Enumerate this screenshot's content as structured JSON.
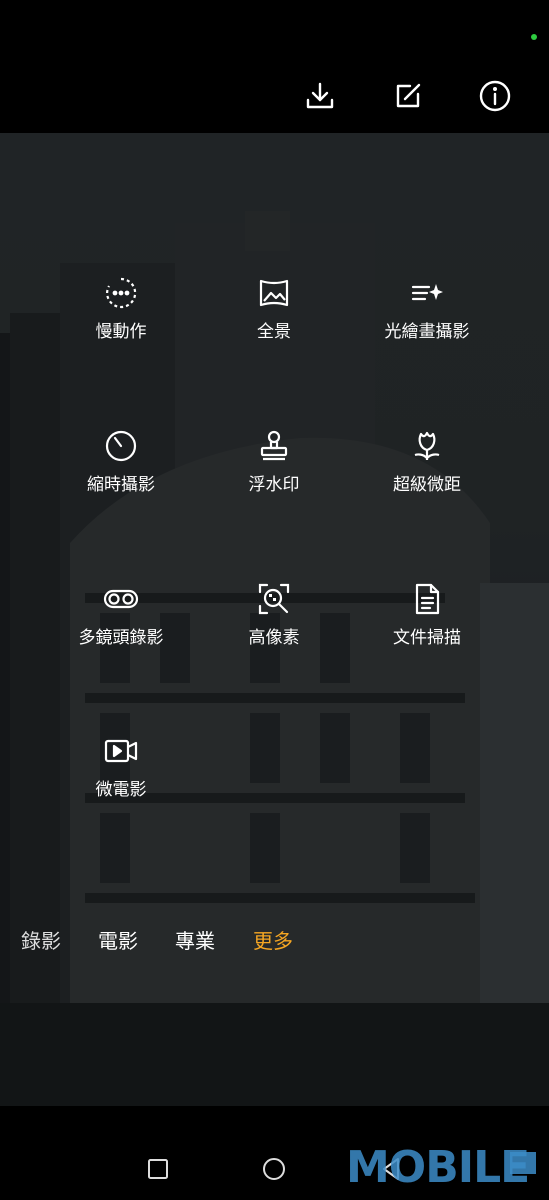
{
  "modes": [
    {
      "label": "慢動作",
      "icon": "slow-motion-icon"
    },
    {
      "label": "全景",
      "icon": "panorama-icon"
    },
    {
      "label": "光繪畫攝影",
      "icon": "light-painting-icon"
    },
    {
      "label": "縮時攝影",
      "icon": "timelapse-icon"
    },
    {
      "label": "浮水印",
      "icon": "watermark-stamp-icon"
    },
    {
      "label": "超級微距",
      "icon": "macro-flower-icon"
    },
    {
      "label": "多鏡頭錄影",
      "icon": "multi-lens-icon"
    },
    {
      "label": "高像素",
      "icon": "high-resolution-icon"
    },
    {
      "label": "文件掃描",
      "icon": "document-scan-icon"
    },
    {
      "label": "微電影",
      "icon": "short-film-icon"
    }
  ],
  "tabs": [
    {
      "label": "錄影",
      "active": false
    },
    {
      "label": "電影",
      "active": false
    },
    {
      "label": "專業",
      "active": false
    },
    {
      "label": "更多",
      "active": true
    }
  ],
  "top_icons": [
    "download-icon",
    "edit-icon",
    "info-icon"
  ],
  "nav_icons": [
    "recents-icon",
    "home-icon",
    "back-icon"
  ],
  "watermark": "MOBILE",
  "colors": {
    "active_tab": "#f5a623",
    "status_dot": "#2ecc40",
    "watermark": "#3c8cc8"
  }
}
